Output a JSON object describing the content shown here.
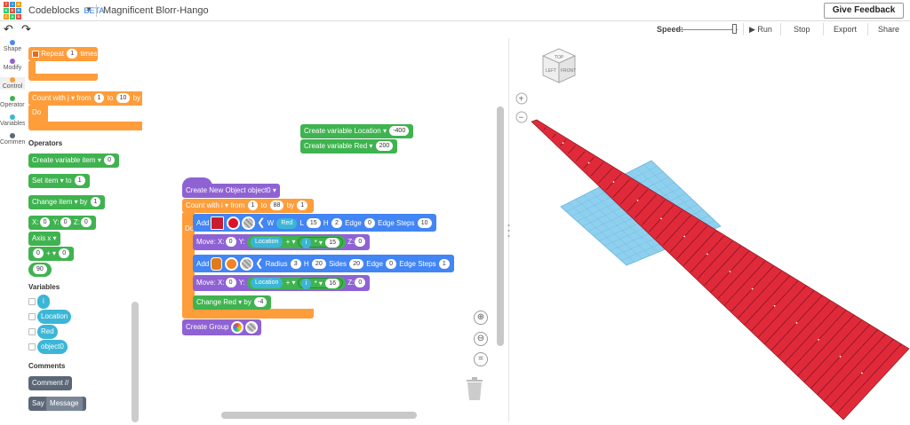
{
  "app": {
    "name": "Codeblocks",
    "badge": "BETA",
    "project_title": "Magnificent Blorr-Hango",
    "feedback_label": "Give Feedback"
  },
  "logo_colors": [
    "#e74c3c",
    "#3498db",
    "#f39c12",
    "#2ecc71",
    "#e74c3c",
    "#3498db",
    "#f39c12",
    "#2ecc71",
    "#e74c3c"
  ],
  "logo_letters": [
    "T",
    "I",
    "N",
    "K",
    "E",
    "R",
    "C",
    "A",
    "D"
  ],
  "toolbar": {
    "undo": "↶",
    "redo": "↷",
    "speed_label": "Speed:",
    "run": "▶ Run",
    "stop": "Stop",
    "export": "Export",
    "share": "Share",
    "speed_value": 0.95
  },
  "categories": [
    {
      "label": "Shape",
      "color": "#4c8be8"
    },
    {
      "label": "Modify",
      "color": "#8f62d4"
    },
    {
      "label": "Control",
      "color": "#ff9d3b"
    },
    {
      "label": "Operators",
      "color": "#3fb34f"
    },
    {
      "label": "Variables",
      "color": "#3cb6d6"
    },
    {
      "label": "Comment",
      "color": "#5b6776"
    }
  ],
  "flyout": {
    "repeat": {
      "label": "Repeat",
      "count": "1",
      "suffix": "times"
    },
    "count_with": {
      "label": "Count with",
      "var": "j ▾",
      "from": "from",
      "start": "1",
      "to": "to",
      "end": "10",
      "by": "by",
      "do": "Do"
    },
    "operators_title": "Operators",
    "create_variable": {
      "label": "Create variable",
      "var": "item ▾",
      "val": "0"
    },
    "set": {
      "label": "Set",
      "var": "item ▾",
      "to": "to",
      "val": "1"
    },
    "change": {
      "label": "Change",
      "var": "item ▾",
      "by": "by",
      "val": "1"
    },
    "xyz": {
      "x": "X:",
      "xv": "0",
      "y": "Y:",
      "yv": "0",
      "z": "Z:",
      "zv": "0"
    },
    "axis": {
      "label": "Axis x ▾"
    },
    "math": {
      "a": "0",
      "op": "+ ▾",
      "b": "0"
    },
    "num": "90",
    "variables_title": "Variables",
    "variables": [
      "i",
      "Location",
      "Red",
      "object0"
    ],
    "comments_title": "Comments",
    "comment_label": "Comment //",
    "say": {
      "label": "Say",
      "msg": "Message"
    }
  },
  "workspace": {
    "cv1": {
      "label": "Create variable",
      "var": "Location ▾",
      "val": "-400"
    },
    "cv2": {
      "label": "Create variable",
      "var": "Red ▾",
      "val": "200"
    },
    "new_object": {
      "label": "Create New Object",
      "var": "object0 ▾"
    },
    "loop": {
      "label": "Count with",
      "var": "i ▾",
      "from": "from",
      "start": "1",
      "to": "to",
      "end": "88",
      "by": "by",
      "step": "1",
      "do": "Do"
    },
    "add_box": {
      "add": "Add",
      "w": "W",
      "w_var": "Red",
      "l": "L",
      "l_val": "15",
      "h": "H",
      "h_val": "2",
      "edge": "Edge",
      "edge_val": "0",
      "steps": "Edge Steps",
      "steps_val": "10"
    },
    "move1": {
      "label": "Move:",
      "x": "X:",
      "xv": "0",
      "y": "Y:",
      "y_var": "Location",
      "op": "+ ▾",
      "i": "i",
      "op2": "* ▾",
      "mul": "15",
      "z": "Z:",
      "zv": "0"
    },
    "add_cyl": {
      "add": "Add",
      "radius": "Radius",
      "radius_val": "3",
      "h": "H",
      "h_val": "20",
      "sides": "Sides",
      "sides_val": "20",
      "edge": "Edge",
      "edge_val": "0",
      "steps": "Edge Steps",
      "steps_val": "1"
    },
    "move2": {
      "label": "Move:",
      "x": "X:",
      "xv": "0",
      "y": "Y:",
      "y_var": "Location",
      "op": "+ ▾",
      "i": "i",
      "op2": "* ▾",
      "mul": "16",
      "z": "Z:",
      "zv": "0"
    },
    "change_red": {
      "label": "Change",
      "var": "Red ▾",
      "by": "by",
      "val": "-4"
    },
    "create_group": {
      "label": "Create Group"
    }
  },
  "viewcube": {
    "top": "TOP",
    "left": "LEFT",
    "front": "FRONT"
  },
  "zoom": {
    "plus": "+",
    "minus": "−",
    "fit": "="
  },
  "scene": {
    "plate_color": "#e02a3a",
    "grid_color": "#7fc8ea"
  }
}
